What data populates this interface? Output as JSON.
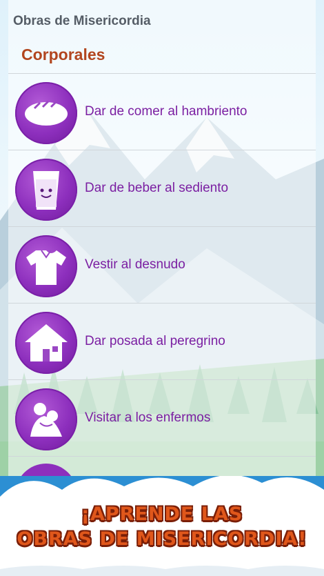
{
  "app_title": "Obras de Misericordia",
  "section_title": "Corporales",
  "items": [
    {
      "label": "Dar de comer al hambriento",
      "icon": "bread-icon"
    },
    {
      "label": "Dar de beber al sediento",
      "icon": "water-glass-icon"
    },
    {
      "label": "Vestir al desnudo",
      "icon": "shirt-icon"
    },
    {
      "label": "Dar posada al peregrino",
      "icon": "house-icon"
    },
    {
      "label": "Visitar a los enfermos",
      "icon": "visiting-sick-icon"
    }
  ],
  "banner": {
    "line1": "¡APRENDE LAS",
    "line2": "OBRAS DE MISERICORDIA!"
  },
  "colors": {
    "accent_purple": "#7b1fa2",
    "section_orange": "#b2461f",
    "banner_blue": "#2c8fd3",
    "banner_text": "#e0571b"
  }
}
